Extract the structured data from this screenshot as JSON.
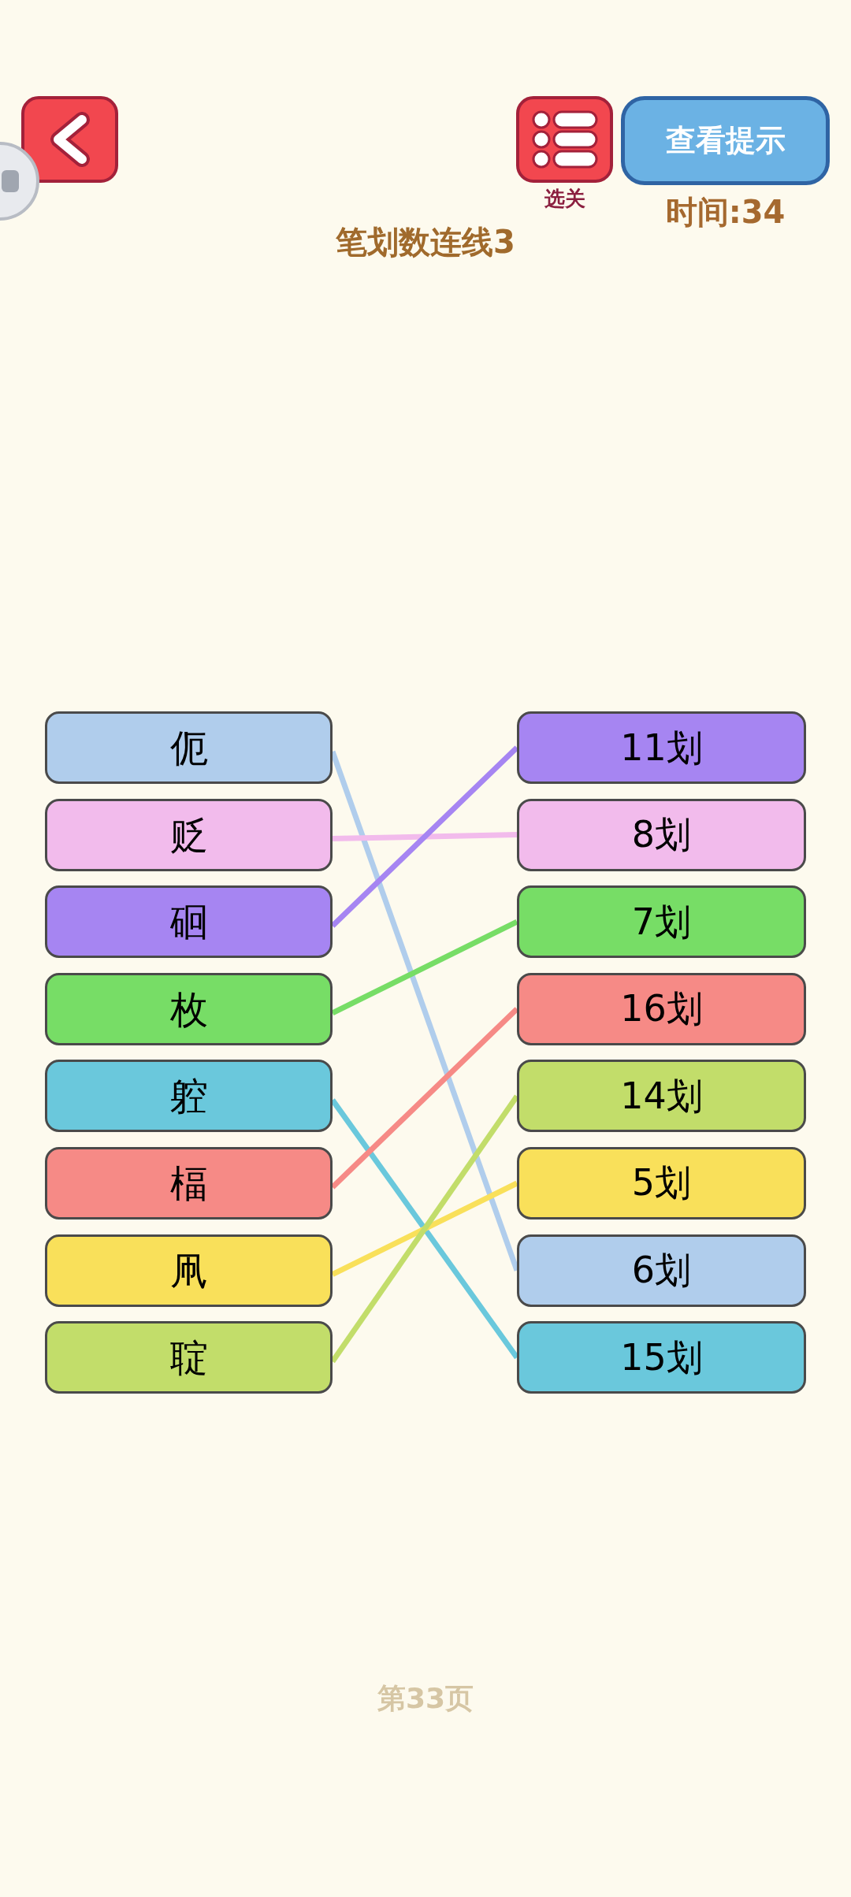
{
  "header": {
    "select_level_label": "选关",
    "hint_button": "查看提示",
    "timer": "时间:34"
  },
  "title": "笔划数连线3",
  "left": [
    {
      "text": "伌",
      "color": "#b0cdec"
    },
    {
      "text": "贬",
      "color": "#f2bbec"
    },
    {
      "text": "硘",
      "color": "#a685f2"
    },
    {
      "text": "枚",
      "color": "#77dd66"
    },
    {
      "text": "躻",
      "color": "#6ac8dc"
    },
    {
      "text": "楅",
      "color": "#f68a86"
    },
    {
      "text": "凧",
      "color": "#f9e05a"
    },
    {
      "text": "聢",
      "color": "#c2dd6a"
    }
  ],
  "right": [
    {
      "text": "11划",
      "color": "#a685f2"
    },
    {
      "text": "8划",
      "color": "#f2bbec"
    },
    {
      "text": "7划",
      "color": "#77dd66"
    },
    {
      "text": "16划",
      "color": "#f68a86"
    },
    {
      "text": "14划",
      "color": "#c2dd6a"
    },
    {
      "text": "5划",
      "color": "#f9e05a"
    },
    {
      "text": "6划",
      "color": "#b0cdec"
    },
    {
      "text": "15划",
      "color": "#6ac8dc"
    }
  ],
  "page_label": "第33页"
}
